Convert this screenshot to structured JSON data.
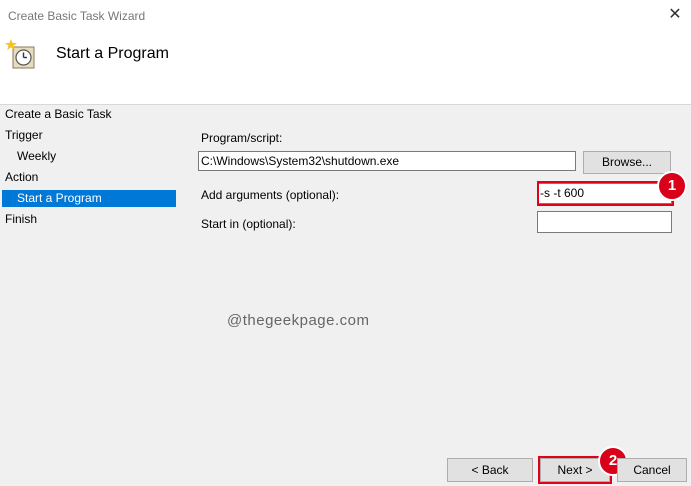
{
  "window": {
    "title": "Create Basic Task Wizard",
    "close_glyph": "✕"
  },
  "header": {
    "title": "Start a Program",
    "icon": "task-scheduler-clock-icon"
  },
  "nav": {
    "items": [
      {
        "label": "Create a Basic Task"
      },
      {
        "label": "Trigger"
      },
      {
        "label": "Weekly"
      },
      {
        "label": "Action"
      },
      {
        "label": "Start a Program"
      },
      {
        "label": "Finish"
      }
    ],
    "selected": "Start a Program"
  },
  "form": {
    "program_label": "Program/script:",
    "program_value": "C:\\Windows\\System32\\shutdown.exe",
    "browse_label": "Browse...",
    "args_label": "Add arguments (optional):",
    "args_value": "-s -t 600",
    "startin_label": "Start in (optional):",
    "startin_value": ""
  },
  "watermark": "@thegeekpage.com",
  "buttons": {
    "back": "< Back",
    "next": "Next >",
    "cancel": "Cancel"
  },
  "annotations": {
    "badge1": "1",
    "badge2": "2",
    "color": "#e3001b"
  },
  "colors": {
    "selection": "#0078d7"
  }
}
